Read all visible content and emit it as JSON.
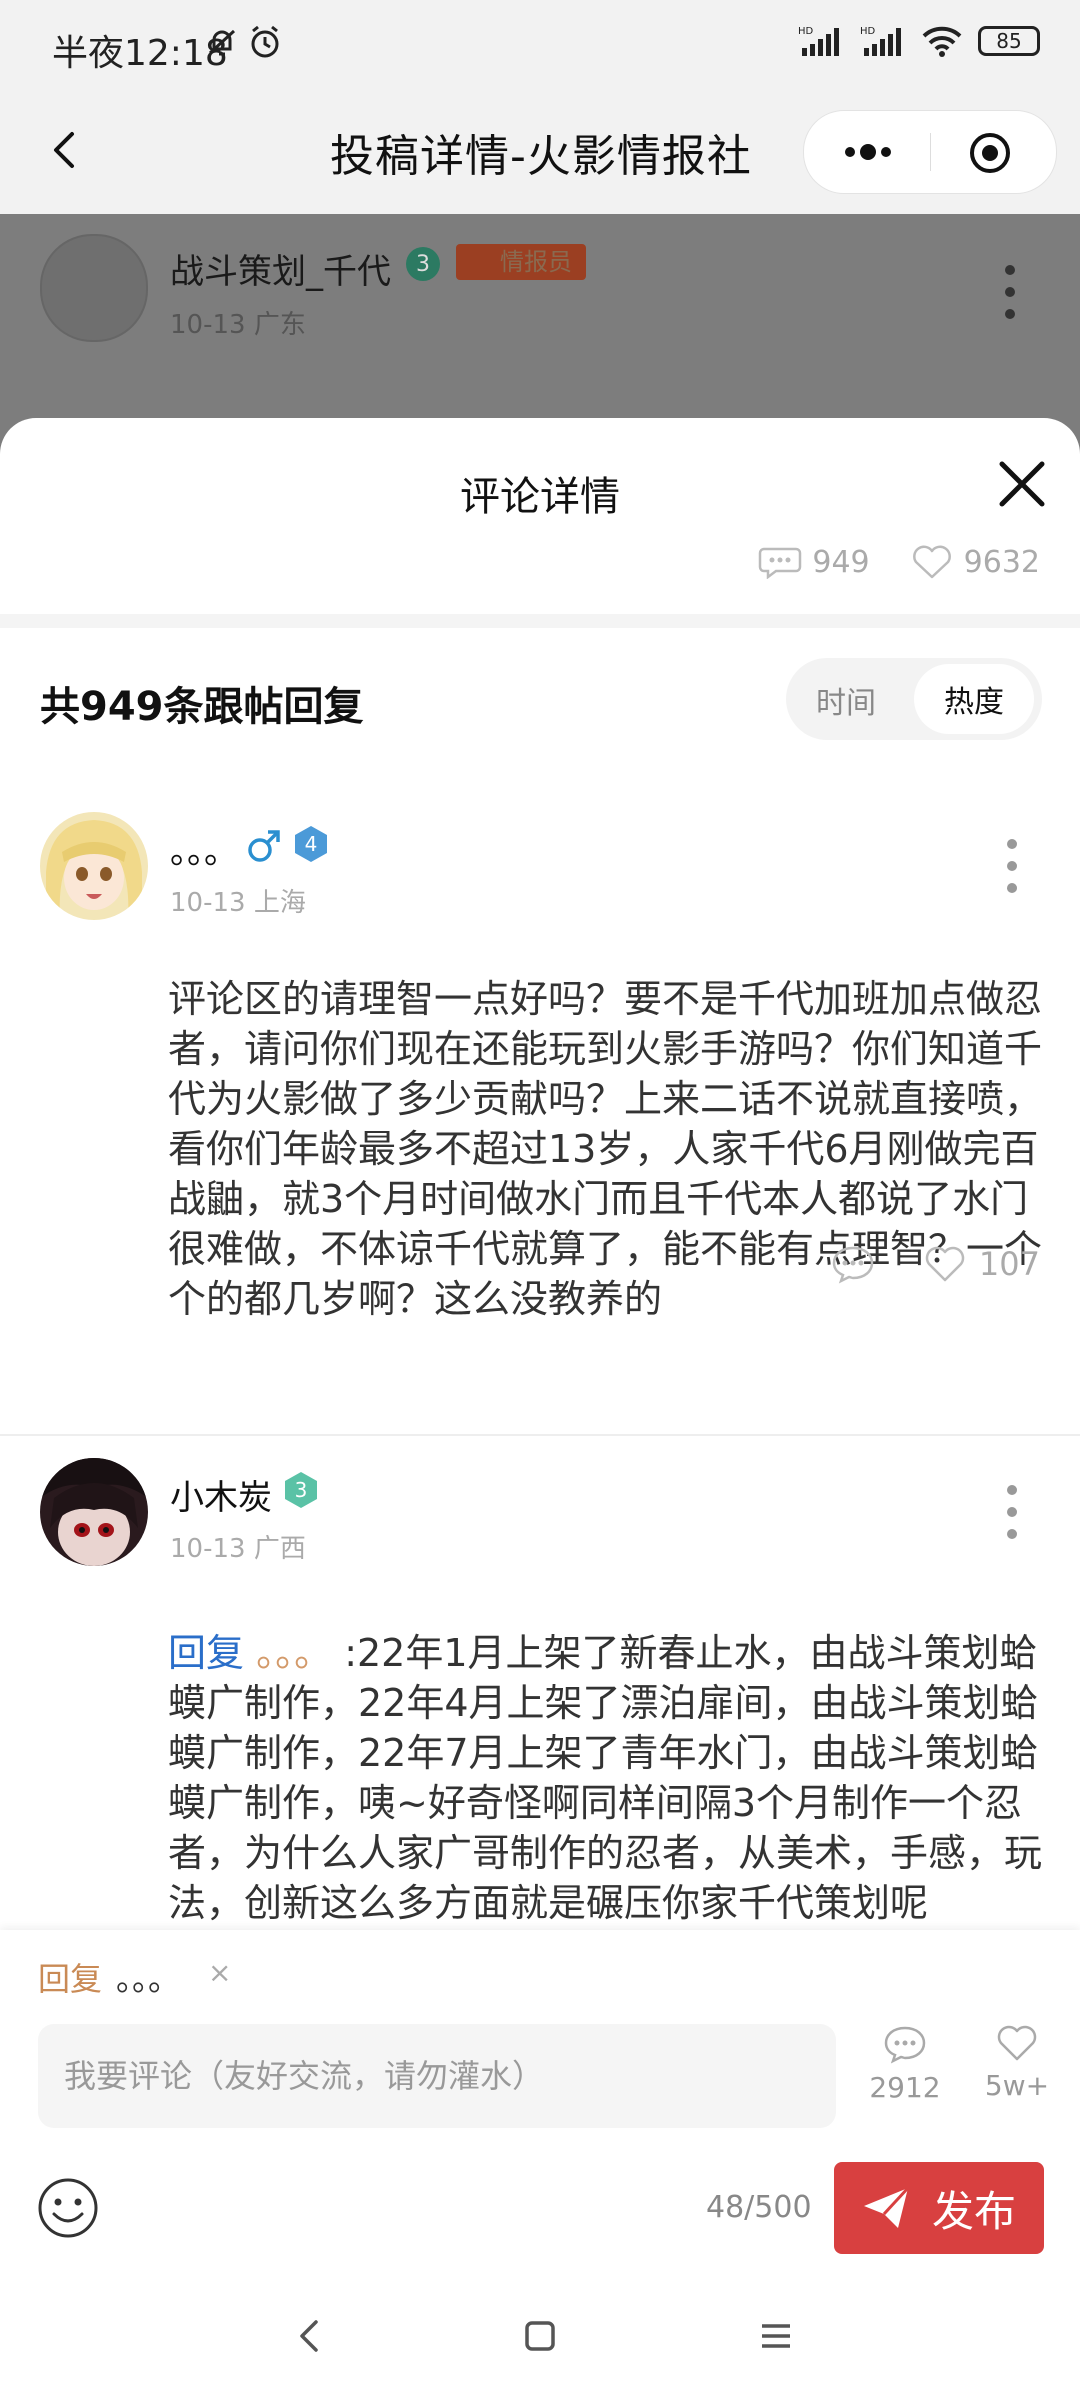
{
  "status_bar": {
    "time": "半夜12:18",
    "battery": "85"
  },
  "nav": {
    "title": "投稿详情-火影情报社"
  },
  "original_post": {
    "author": "战斗策划_千代",
    "level": "3",
    "badge": "情报员",
    "meta": "10-13 广东"
  },
  "sheet": {
    "title": "评论详情",
    "comments_count": "949",
    "likes_count": "9632",
    "replies_heading": "共949条跟帖回复",
    "sort": {
      "time_label": "时间",
      "hot_label": "热度",
      "active": "热度"
    }
  },
  "comments": [
    {
      "name": "。。。",
      "level": "4",
      "meta": "10-13 上海",
      "text": "评论区的请理智一点好吗？要不是千代加班加点做忍者，请问你们现在还能玩到火影手游吗？你们知道千代为火影做了多少贡献吗？上来二话不说就直接喷，看你们年龄最多不超过13岁，人家千代6月刚做完百战鼬，就3个月时间做水门而且千代本人都说了水门很难做，不体谅千代就算了，能不能有点理智？一个个的都几岁啊？这么没教养的",
      "likes": "107"
    },
    {
      "name": "小木炭",
      "level": "3",
      "meta": "10-13 广西",
      "reply_prefix": "回复",
      "reply_to": "。。。",
      "text": " :22年1月上架了新春止水，由战斗策划蛤蟆广制作，22年4月上架了漂泊扉间，由战斗策划蛤蟆广制作，22年7月上架了青年水门，由战斗策划蛤蟆广制作，咦~好奇怪啊同样间隔3个月制作一个忍者，为什么人家广哥制作的忍者，从美术，手感，玩法，创新这么多方面就是碾压你家千代策划呢"
    }
  ],
  "composer": {
    "reply_label": "回复",
    "reply_target": "。。。",
    "clear_symbol": "×",
    "placeholder": "我要评论（友好交流，请勿灌水）",
    "comment_count": "2912",
    "like_count": "5w+",
    "char_count": "48/500",
    "publish_label": "发布"
  }
}
